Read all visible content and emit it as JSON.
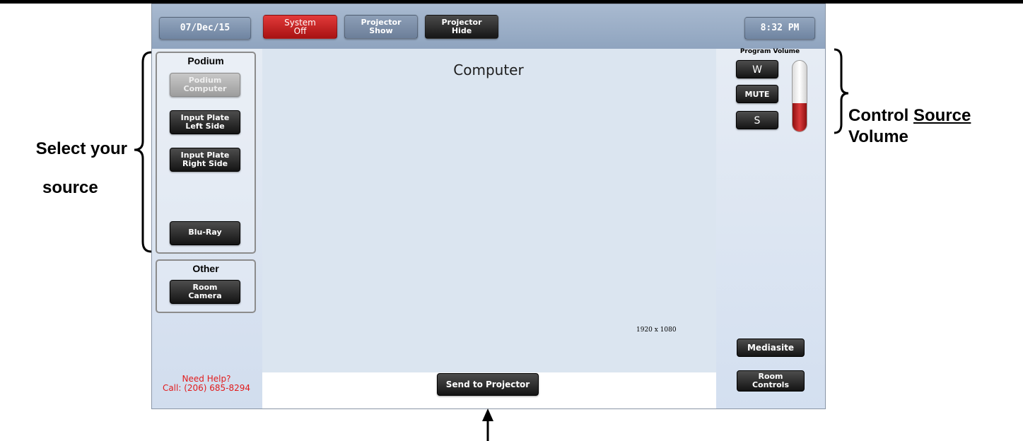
{
  "header": {
    "date": "07/Dec/15",
    "system_off": [
      "System",
      "Off"
    ],
    "projector_show": [
      "Projector",
      "Show"
    ],
    "projector_hide": [
      "Projector",
      "Hide"
    ],
    "time": "8:32 PM"
  },
  "sources": {
    "podium_title": "Podium",
    "podium_items": [
      {
        "line1": "Podium",
        "line2": "Computer"
      },
      {
        "line1": "Input Plate",
        "line2": "Left Side"
      },
      {
        "line1": "Input Plate",
        "line2": "Right Side"
      },
      {
        "label": "Blu-Ray"
      }
    ],
    "other_title": "Other",
    "other_items": [
      {
        "line1": "Room",
        "line2": "Camera"
      }
    ]
  },
  "help": {
    "line1": "Need Help?",
    "line2": "Call: (206) 685-8294"
  },
  "center": {
    "title": "Computer",
    "resolution": "1920 x 1080",
    "send_button": "Send to Projector"
  },
  "volume": {
    "label": "Program Volume",
    "up": "W",
    "mute": "MUTE",
    "down": "S",
    "level_percent": 40
  },
  "right_buttons": {
    "mediasite": "Mediasite",
    "room_controls": [
      "Room",
      "Controls"
    ]
  },
  "annotations": {
    "select_line1": "Select your",
    "select_line2": "source",
    "control_prefix": "Control ",
    "control_source": "Source",
    "volume": "Volume"
  },
  "colors": {
    "accent_red": "#c41e1e",
    "help_red": "#e21b1b",
    "header_blue": "#9fb2c9"
  }
}
